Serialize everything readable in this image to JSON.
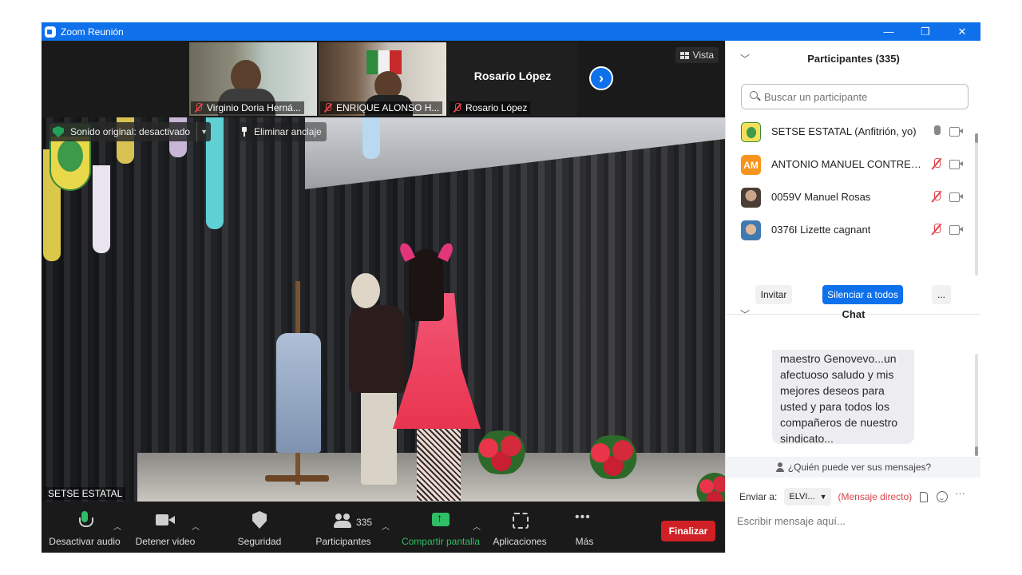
{
  "window": {
    "title": "Zoom Reunión",
    "controls": [
      "—",
      "❐",
      "✕"
    ]
  },
  "thumbnails": [
    {
      "name": "Virginio Doria Herná..."
    },
    {
      "name": "ENRIQUE ALONSO H..."
    },
    {
      "name": "Rosario López",
      "display_name": "Rosario López"
    }
  ],
  "view_button": "Vista",
  "main_video": {
    "sound_label": "Sonido original: desactivado",
    "unpin_label": "Eliminar anclaje",
    "speaker_name": "SETSE ESTATAL"
  },
  "toolbar": {
    "audio": "Desactivar audio",
    "video": "Detener video",
    "security": "Seguridad",
    "participants": "Participantes",
    "participants_count": "335",
    "share": "Compartir pantalla",
    "apps": "Aplicaciones",
    "more": "Más",
    "end": "Finalizar"
  },
  "participants_panel": {
    "title": "Participantes (335)",
    "search_placeholder": "Buscar un participante",
    "items": [
      {
        "name": "SETSE ESTATAL (Anfitrión, yo)",
        "avatar_color": "#f2e05a",
        "initials": "",
        "mic": "live"
      },
      {
        "name": "ANTONIO MANUEL CONTRER...",
        "avatar_color": "#f7941d",
        "initials": "AM",
        "mic": "muted"
      },
      {
        "name": "0059V Manuel Rosas",
        "avatar_color": "#6b5a4e",
        "initials": "",
        "mic": "muted"
      },
      {
        "name": "0376I Lizette cagnant",
        "avatar_color": "#4a78a8",
        "initials": "",
        "mic": "muted"
      }
    ],
    "invite": "Invitar",
    "mute_all": "Silenciar a todos",
    "more": "..."
  },
  "chat_panel": {
    "title": "Chat",
    "message": "maestro Genovevo...un afectuoso saludo y mis mejores deseos para usted y para todos los compañeros de nuestro sindicato...",
    "who_can_see": "¿Quién puede ver sus mensajes?",
    "send_to_label": "Enviar a:",
    "send_to_value": "ELVI...",
    "direct_message": "(Mensaje directo)",
    "input_placeholder": "Escribir mensaje aquí..."
  },
  "colors": {
    "titlebar": "#0e71eb",
    "accent": "#0e71eb",
    "end_button": "#d02025",
    "share_green": "#2fbd65",
    "mute_red": "#e0454a"
  }
}
